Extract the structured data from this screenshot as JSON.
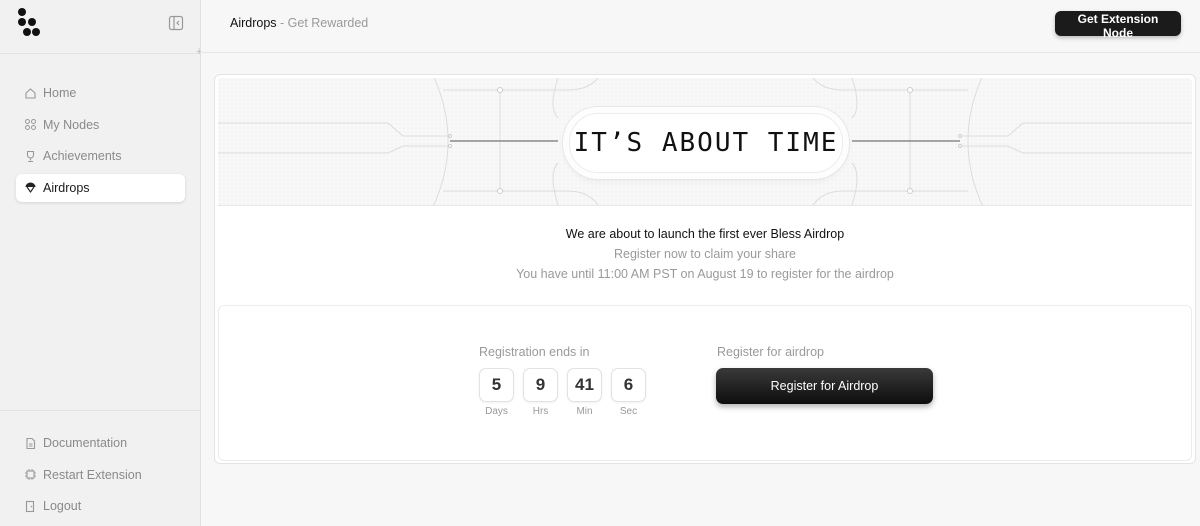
{
  "header": {
    "title": "Airdrops",
    "separator": " - ",
    "subtitle": "Get Rewarded",
    "cta_label": "Get Extension Node"
  },
  "sidebar": {
    "items": [
      {
        "label": "Home",
        "icon": "home-icon"
      },
      {
        "label": "My Nodes",
        "icon": "nodes-icon"
      },
      {
        "label": "Achievements",
        "icon": "trophy-icon"
      },
      {
        "label": "Airdrops",
        "icon": "airdrop-icon",
        "active": true
      }
    ],
    "bottom_items": [
      {
        "label": "Documentation",
        "icon": "document-icon"
      },
      {
        "label": "Restart Extension",
        "icon": "restart-icon"
      },
      {
        "label": "Logout",
        "icon": "logout-icon"
      }
    ]
  },
  "banner": {
    "headline": "IT’S ABOUT TIME"
  },
  "messages": {
    "line1": "We are about to launch the first ever Bless Airdrop",
    "line2": "Register now to claim your share",
    "line3": "You have until 11:00 AM PST on August 19 to register for the airdrop"
  },
  "registration": {
    "countdown_label": "Registration ends in",
    "register_label": "Register for airdrop",
    "button_label": "Register for Airdrop",
    "countdown": [
      {
        "value": "5",
        "unit": "Days"
      },
      {
        "value": "9",
        "unit": "Hrs"
      },
      {
        "value": "41",
        "unit": "Min"
      },
      {
        "value": "6",
        "unit": "Sec"
      }
    ]
  },
  "colors": {
    "accent": "#1b1b1b",
    "muted_text": "#9a9a9a",
    "background": "#f7f7f7"
  }
}
